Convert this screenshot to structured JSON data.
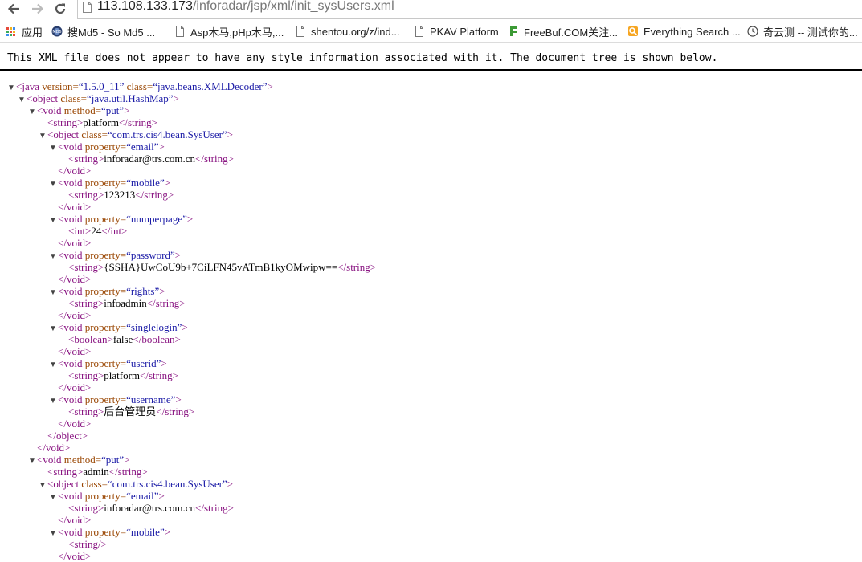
{
  "browser": {
    "url_host": "113.108.133.173",
    "url_path": "/inforadar/jsp/xml/init_sysUsers.xml"
  },
  "bookmarks": [
    {
      "label": "应用",
      "icon": "apps-grid-icon"
    },
    {
      "label": "搜Md5 - So Md5 ...",
      "icon": "md5-site-icon"
    },
    {
      "label": "Asp木马,pHp木马,...",
      "icon": "page-icon"
    },
    {
      "label": "shentou.org/z/ind...",
      "icon": "page-icon"
    },
    {
      "label": "PKAV Platform",
      "icon": "page-icon"
    },
    {
      "label": "FreeBuf.COM关注...",
      "icon": "freebuf-icon"
    },
    {
      "label": "Everything Search ...",
      "icon": "everything-search-icon"
    },
    {
      "label": "奇云测 -- 测试你的...",
      "icon": "clock-icon"
    }
  ],
  "xml_viewer": {
    "notice": "This XML file does not appear to have any style information associated with it. The document tree is shown below."
  },
  "tree": [
    {
      "d": 0,
      "tw": "▼",
      "p": [
        [
          "t",
          "<java "
        ],
        [
          "n",
          "version="
        ],
        [
          "v",
          "“1.5.0_11”"
        ],
        [
          "t",
          " "
        ],
        [
          "n",
          "class="
        ],
        [
          "v",
          "“java.beans.XMLDecoder”"
        ],
        [
          "t",
          ">"
        ]
      ]
    },
    {
      "d": 1,
      "tw": "▼",
      "p": [
        [
          "t",
          "<object "
        ],
        [
          "n",
          "class="
        ],
        [
          "v",
          "“java.util.HashMap”"
        ],
        [
          "t",
          ">"
        ]
      ]
    },
    {
      "d": 2,
      "tw": "▼",
      "p": [
        [
          "t",
          "<void "
        ],
        [
          "n",
          "method="
        ],
        [
          "v",
          "“put”"
        ],
        [
          "t",
          ">"
        ]
      ]
    },
    {
      "d": 3,
      "tw": "",
      "p": [
        [
          "t",
          "<string>"
        ],
        [
          "x",
          "platform"
        ],
        [
          "t",
          "</string>"
        ]
      ]
    },
    {
      "d": 3,
      "tw": "▼",
      "p": [
        [
          "t",
          "<object "
        ],
        [
          "n",
          "class="
        ],
        [
          "v",
          "“com.trs.cis4.bean.SysUser”"
        ],
        [
          "t",
          ">"
        ]
      ]
    },
    {
      "d": 4,
      "tw": "▼",
      "p": [
        [
          "t",
          "<void "
        ],
        [
          "n",
          "property="
        ],
        [
          "v",
          "“email”"
        ],
        [
          "t",
          ">"
        ]
      ]
    },
    {
      "d": 5,
      "tw": "",
      "p": [
        [
          "t",
          "<string>"
        ],
        [
          "x",
          "inforadar@trs.com.cn"
        ],
        [
          "t",
          "</string>"
        ]
      ]
    },
    {
      "d": 4,
      "tw": "",
      "p": [
        [
          "t",
          "</void>"
        ]
      ]
    },
    {
      "d": 4,
      "tw": "▼",
      "p": [
        [
          "t",
          "<void "
        ],
        [
          "n",
          "property="
        ],
        [
          "v",
          "“mobile”"
        ],
        [
          "t",
          ">"
        ]
      ]
    },
    {
      "d": 5,
      "tw": "",
      "p": [
        [
          "t",
          "<string>"
        ],
        [
          "x",
          "123213"
        ],
        [
          "t",
          "</string>"
        ]
      ]
    },
    {
      "d": 4,
      "tw": "",
      "p": [
        [
          "t",
          "</void>"
        ]
      ]
    },
    {
      "d": 4,
      "tw": "▼",
      "p": [
        [
          "t",
          "<void "
        ],
        [
          "n",
          "property="
        ],
        [
          "v",
          "“numperpage”"
        ],
        [
          "t",
          ">"
        ]
      ]
    },
    {
      "d": 5,
      "tw": "",
      "p": [
        [
          "t",
          "<int>"
        ],
        [
          "x",
          "24"
        ],
        [
          "t",
          "</int>"
        ]
      ]
    },
    {
      "d": 4,
      "tw": "",
      "p": [
        [
          "t",
          "</void>"
        ]
      ]
    },
    {
      "d": 4,
      "tw": "▼",
      "p": [
        [
          "t",
          "<void "
        ],
        [
          "n",
          "property="
        ],
        [
          "v",
          "“password”"
        ],
        [
          "t",
          ">"
        ]
      ]
    },
    {
      "d": 5,
      "tw": "",
      "p": [
        [
          "t",
          "<string>"
        ],
        [
          "x",
          "{SSHA}UwCoU9b+7CiLFN45vATmB1kyOMwipw=="
        ],
        [
          "t",
          "</string>"
        ]
      ]
    },
    {
      "d": 4,
      "tw": "",
      "p": [
        [
          "t",
          "</void>"
        ]
      ]
    },
    {
      "d": 4,
      "tw": "▼",
      "p": [
        [
          "t",
          "<void "
        ],
        [
          "n",
          "property="
        ],
        [
          "v",
          "“rights”"
        ],
        [
          "t",
          ">"
        ]
      ]
    },
    {
      "d": 5,
      "tw": "",
      "p": [
        [
          "t",
          "<string>"
        ],
        [
          "x",
          "infoadmin"
        ],
        [
          "t",
          "</string>"
        ]
      ]
    },
    {
      "d": 4,
      "tw": "",
      "p": [
        [
          "t",
          "</void>"
        ]
      ]
    },
    {
      "d": 4,
      "tw": "▼",
      "p": [
        [
          "t",
          "<void "
        ],
        [
          "n",
          "property="
        ],
        [
          "v",
          "“singlelogin”"
        ],
        [
          "t",
          ">"
        ]
      ]
    },
    {
      "d": 5,
      "tw": "",
      "p": [
        [
          "t",
          "<boolean>"
        ],
        [
          "x",
          "false"
        ],
        [
          "t",
          "</boolean>"
        ]
      ]
    },
    {
      "d": 4,
      "tw": "",
      "p": [
        [
          "t",
          "</void>"
        ]
      ]
    },
    {
      "d": 4,
      "tw": "▼",
      "p": [
        [
          "t",
          "<void "
        ],
        [
          "n",
          "property="
        ],
        [
          "v",
          "“userid”"
        ],
        [
          "t",
          ">"
        ]
      ]
    },
    {
      "d": 5,
      "tw": "",
      "p": [
        [
          "t",
          "<string>"
        ],
        [
          "x",
          "platform"
        ],
        [
          "t",
          "</string>"
        ]
      ]
    },
    {
      "d": 4,
      "tw": "",
      "p": [
        [
          "t",
          "</void>"
        ]
      ]
    },
    {
      "d": 4,
      "tw": "▼",
      "p": [
        [
          "t",
          "<void "
        ],
        [
          "n",
          "property="
        ],
        [
          "v",
          "“username”"
        ],
        [
          "t",
          ">"
        ]
      ]
    },
    {
      "d": 5,
      "tw": "",
      "p": [
        [
          "t",
          "<string>"
        ],
        [
          "x",
          "后台管理员"
        ],
        [
          "t",
          "</string>"
        ]
      ]
    },
    {
      "d": 4,
      "tw": "",
      "p": [
        [
          "t",
          "</void>"
        ]
      ]
    },
    {
      "d": 3,
      "tw": "",
      "p": [
        [
          "t",
          "</object>"
        ]
      ]
    },
    {
      "d": 2,
      "tw": "",
      "p": [
        [
          "t",
          "</void>"
        ]
      ]
    },
    {
      "d": 2,
      "tw": "▼",
      "p": [
        [
          "t",
          "<void "
        ],
        [
          "n",
          "method="
        ],
        [
          "v",
          "“put”"
        ],
        [
          "t",
          ">"
        ]
      ]
    },
    {
      "d": 3,
      "tw": "",
      "p": [
        [
          "t",
          "<string>"
        ],
        [
          "x",
          "admin"
        ],
        [
          "t",
          "</string>"
        ]
      ]
    },
    {
      "d": 3,
      "tw": "▼",
      "p": [
        [
          "t",
          "<object "
        ],
        [
          "n",
          "class="
        ],
        [
          "v",
          "“com.trs.cis4.bean.SysUser”"
        ],
        [
          "t",
          ">"
        ]
      ]
    },
    {
      "d": 4,
      "tw": "▼",
      "p": [
        [
          "t",
          "<void "
        ],
        [
          "n",
          "property="
        ],
        [
          "v",
          "“email”"
        ],
        [
          "t",
          ">"
        ]
      ]
    },
    {
      "d": 5,
      "tw": "",
      "p": [
        [
          "t",
          "<string>"
        ],
        [
          "x",
          "inforadar@trs.com.cn"
        ],
        [
          "t",
          "</string>"
        ]
      ]
    },
    {
      "d": 4,
      "tw": "",
      "p": [
        [
          "t",
          "</void>"
        ]
      ]
    },
    {
      "d": 4,
      "tw": "▼",
      "p": [
        [
          "t",
          "<void "
        ],
        [
          "n",
          "property="
        ],
        [
          "v",
          "“mobile”"
        ],
        [
          "t",
          ">"
        ]
      ]
    },
    {
      "d": 5,
      "tw": "",
      "p": [
        [
          "t",
          "<string/>"
        ]
      ]
    },
    {
      "d": 4,
      "tw": "",
      "p": [
        [
          "t",
          "</void>"
        ]
      ]
    }
  ]
}
